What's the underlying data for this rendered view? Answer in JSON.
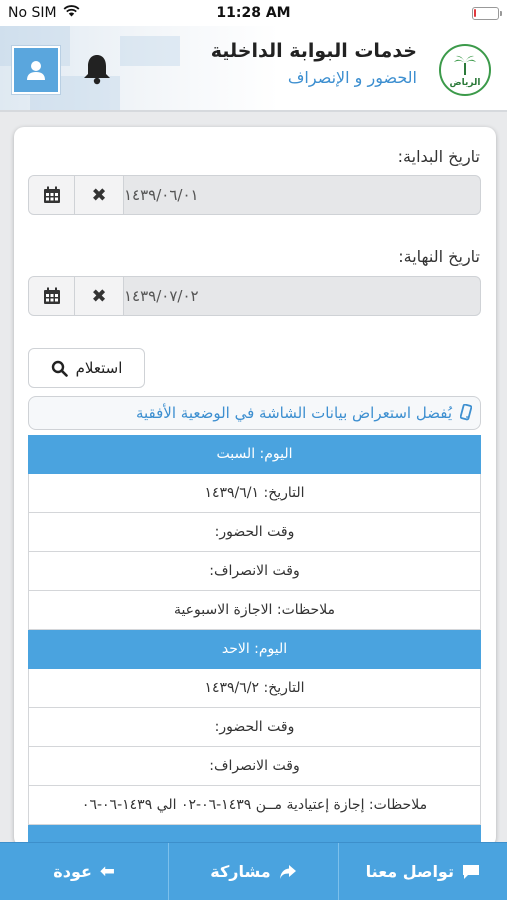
{
  "status_bar": {
    "carrier": "No SIM",
    "time": "11:28 AM",
    "battery_level": 0.1
  },
  "header": {
    "title": "خدمات البوابة الداخلية",
    "subtitle": "الحضور و الإنصراف",
    "logo_text": "الرياض"
  },
  "form": {
    "start_label": "تاريخ البداية:",
    "start_value": "١٤٣٩/٠٦/٠١",
    "end_label": "تاريخ النهاية:",
    "end_value": "١٤٣٩/٠٧/٠٢",
    "search_label": "استعلام",
    "hint": "يُفضل استعراض بيانات الشاشة في الوضعية الأفقية"
  },
  "records": [
    {
      "day": "اليوم: السبت",
      "date": "التاريخ: ١٤٣٩/٦/١",
      "check_in": "وقت الحضور:",
      "check_out": "وقت الانصراف:",
      "notes": "ملاحظات: الاجازة الاسبوعية"
    },
    {
      "day": "اليوم: الاحد",
      "date": "التاريخ: ١٤٣٩/٦/٢",
      "check_in": "وقت الحضور:",
      "check_out": "وقت الانصراف:",
      "notes": "ملاحظات: إجازة إعتيادية مــن ١٤٣٩-٠٦-٠٢ الي ١٤٣٩-٠٦-٠٦"
    }
  ],
  "bottom_bar": {
    "contact": "تواصل معنا",
    "share": "مشاركة",
    "back": "عودة"
  },
  "colors": {
    "accent": "#4aa3df",
    "subtitle": "#3d8fd0",
    "battery": "#e0393e"
  }
}
